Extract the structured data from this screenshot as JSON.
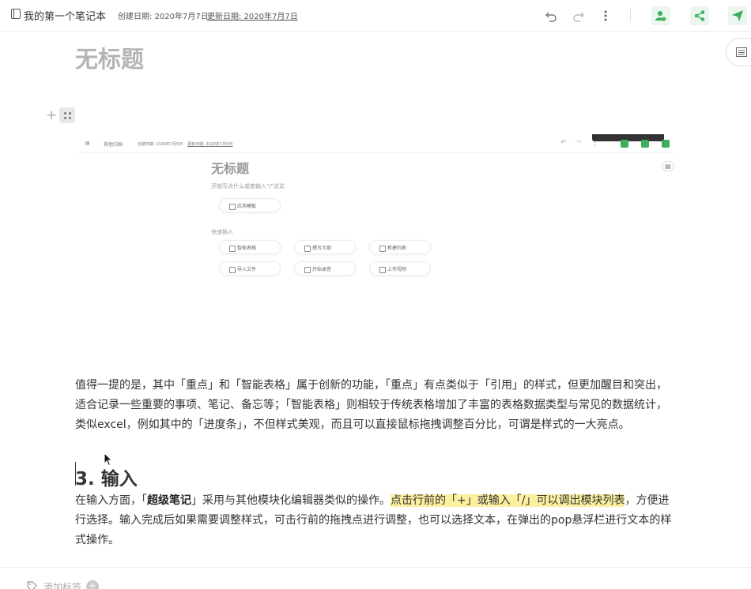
{
  "header": {
    "notebook_title": "我的第一个笔记本",
    "created": "创建日期: 2020年7月7日",
    "updated": "更新日期: 2020年7月7日",
    "toolbar_icons": [
      "undo-icon",
      "redo-icon",
      "more-vertical-icon",
      "add-collaborator-icon",
      "share-icon",
      "send-icon"
    ],
    "accent_color": "#3cae5c"
  },
  "document": {
    "title": "无标题",
    "embedded_screenshot": {
      "notebook_title": "其他归档",
      "created": "创建日期: 2020年7月5日",
      "updated": "更新日期: 2020年7月5日",
      "title": "无标题",
      "placeholder": "开始写点什么或者输入\"/\"试试",
      "apply_template": "应用模板",
      "quick_insert_label": "快速插入",
      "quick_items": [
        "智能表格",
        "撰写大纲",
        "新建列表",
        "导入文件",
        "开始录音",
        "上传视频"
      ]
    },
    "paragraph1": "值得一提的是，其中「重点」和「智能表格」属于创新的功能，「重点」有点类似于「引用」的样式，但更加醒目和突出，适合记录一些重要的事项、笔记、备忘等；「智能表格」则相较于传统表格增加了丰富的表格数据类型与常见的数据统计，类似excel，例如其中的「进度条」，不但样式美观，而且可以直接鼠标拖拽调整百分比，可谓是样式的一大亮点。",
    "heading": "3.  输入",
    "paragraph2": {
      "part1": "在输入方面，「",
      "bold": "超级笔记",
      "part2": "」采用与其他模块化编辑器类似的操作。",
      "highlight": "点击行前的「+」或输入「/」可以调出模块列表",
      "part3": "，方便进行选择。输入完成后如果需要调整样式，可击行前的拖拽点进行调整，也可以选择文本，在弹出的pop悬浮栏进行文本的样式操作。",
      "highlight_color": "#fbf0a0"
    }
  },
  "footer": {
    "add_tag": "添加标签"
  }
}
